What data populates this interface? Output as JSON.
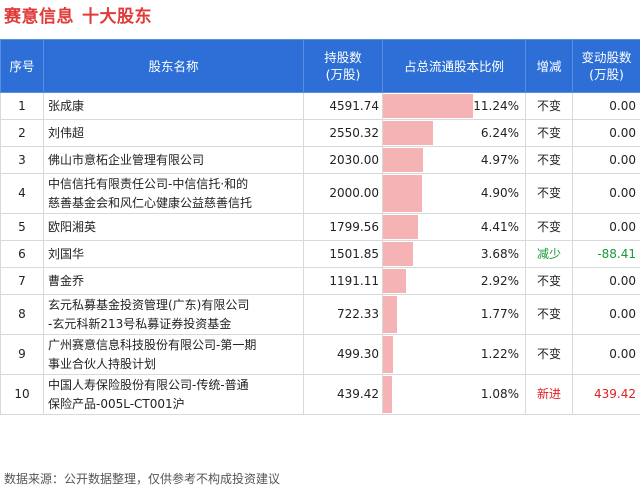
{
  "title": "赛意信息",
  "subtitle": "十大股东",
  "headers": {
    "idx": "序号",
    "name": "股东名称",
    "hold_l1": "持股数",
    "hold_l2": "(万股)",
    "ratio": "占总流通股本比例",
    "chg": "增减",
    "amt_l1": "变动股数",
    "amt_l2": "(万股)"
  },
  "rows": [
    {
      "idx": "1",
      "name": [
        "张成康"
      ],
      "hold": "4591.74",
      "ratio": 11.24,
      "ratio_text": "11.24%",
      "chg": "不变",
      "chg_type": "same",
      "amt": "0.00"
    },
    {
      "idx": "2",
      "name": [
        "刘伟超"
      ],
      "hold": "2550.32",
      "ratio": 6.24,
      "ratio_text": "6.24%",
      "chg": "不变",
      "chg_type": "same",
      "amt": "0.00"
    },
    {
      "idx": "3",
      "name": [
        "佛山市意柘企业管理有限公司"
      ],
      "hold": "2030.00",
      "ratio": 4.97,
      "ratio_text": "4.97%",
      "chg": "不变",
      "chg_type": "same",
      "amt": "0.00"
    },
    {
      "idx": "4",
      "name": [
        "中信信托有限责任公司-中信信托·和的",
        "慈善基金会和风仁心健康公益慈善信托"
      ],
      "hold": "2000.00",
      "ratio": 4.9,
      "ratio_text": "4.90%",
      "chg": "不变",
      "chg_type": "same",
      "amt": "0.00"
    },
    {
      "idx": "5",
      "name": [
        "欧阳湘英"
      ],
      "hold": "1799.56",
      "ratio": 4.41,
      "ratio_text": "4.41%",
      "chg": "不变",
      "chg_type": "same",
      "amt": "0.00"
    },
    {
      "idx": "6",
      "name": [
        "刘国华"
      ],
      "hold": "1501.85",
      "ratio": 3.68,
      "ratio_text": "3.68%",
      "chg": "减少",
      "chg_type": "down",
      "amt": "-88.41"
    },
    {
      "idx": "7",
      "name": [
        "曹金乔"
      ],
      "hold": "1191.11",
      "ratio": 2.92,
      "ratio_text": "2.92%",
      "chg": "不变",
      "chg_type": "same",
      "amt": "0.00"
    },
    {
      "idx": "8",
      "name": [
        "玄元私募基金投资管理(广东)有限公司",
        "-玄元科新213号私募证券投资基金"
      ],
      "hold": "722.33",
      "ratio": 1.77,
      "ratio_text": "1.77%",
      "chg": "不变",
      "chg_type": "same",
      "amt": "0.00"
    },
    {
      "idx": "9",
      "name": [
        "广州赛意信息科技股份有限公司-第一期",
        "事业合伙人持股计划"
      ],
      "hold": "499.30",
      "ratio": 1.22,
      "ratio_text": "1.22%",
      "chg": "不变",
      "chg_type": "same",
      "amt": "0.00"
    },
    {
      "idx": "10",
      "name": [
        "中国人寿保险股份有限公司-传统-普通",
        "保险产品-005L-CT001沪"
      ],
      "hold": "439.42",
      "ratio": 1.08,
      "ratio_text": "1.08%",
      "chg": "新进",
      "chg_type": "new",
      "amt": "439.42"
    }
  ],
  "colors": {
    "brand": "#e03a3a",
    "header": "#2d6fd6",
    "bar": "#f6b3b5",
    "down": "#1a9a3a",
    "up": "#e02020"
  },
  "source": "数据来源：公开数据整理，仅供参考不构成投资建议"
}
